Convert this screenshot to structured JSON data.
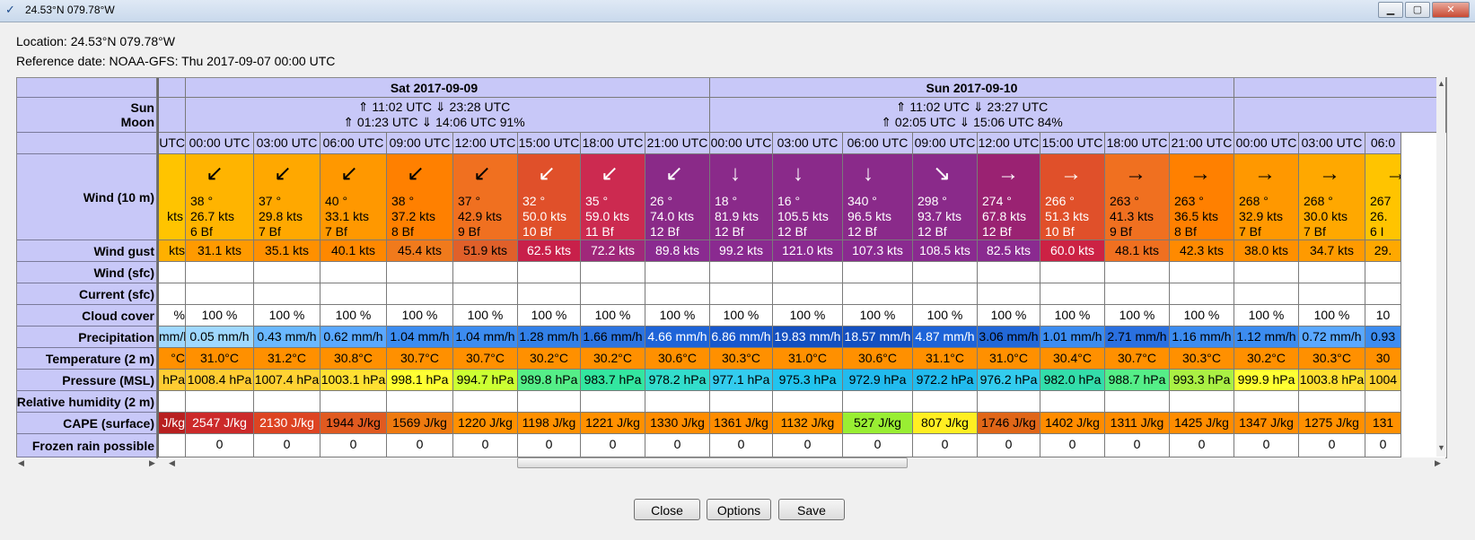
{
  "window": {
    "title": "24.53°N 079.78°W"
  },
  "location_text": "Location: 24.53°N 079.78°W",
  "reference_text": "Reference date: NOAA-GFS: Thu 2017-09-07 00:00 UTC",
  "row_labels": {
    "sun": "Sun",
    "moon": "Moon",
    "wind": "Wind (10 m)",
    "gust": "Wind gust",
    "wind_sfc": "Wind (sfc)",
    "current": "Current (sfc)",
    "cloud": "Cloud cover",
    "precip": "Precipitation",
    "temp": "Temperature (2 m)",
    "pressure": "Pressure (MSL)",
    "humidity": "Relative humidity (2 m)",
    "cape": "CAPE (surface)",
    "frozen": "Frozen rain possible"
  },
  "days": [
    {
      "label": "Sat 2017-09-09",
      "sun": "⇑ 11:02 UTC ⇓ 23:28 UTC",
      "moon": "⇑ 01:23 UTC ⇓ 14:06 UTC  91%"
    },
    {
      "label": "Sun 2017-09-10",
      "sun": "⇑ 11:02 UTC ⇓ 23:27 UTC",
      "moon": "⇑ 02:05 UTC ⇓ 15:06 UTC  84%"
    }
  ],
  "partial_col": {
    "time": "UTC",
    "wind": "kts",
    "gust": "kts",
    "cloud": "%",
    "precip": "mm/h",
    "temp": "°C",
    "pressure": "hPa",
    "cape": "J/kg"
  },
  "columns": [
    {
      "time": "00:00 UTC",
      "dir": "38 °",
      "speed": "26.7  kts",
      "bf": "6 Bf",
      "gust": "31.1  kts",
      "cloud": "100 %",
      "precip": "0.05 mm/h",
      "temp": "31.0°C",
      "pressure": "1008.4 hPa",
      "cape": "2547 J/kg",
      "frozen": "0",
      "wind_color": "#ffb400",
      "gust_color": "#ff9a00",
      "precip_color": "#9fd8ff",
      "pressure_color": "#ffcc33",
      "cape_color": "#cc2a2a",
      "arrow": "↙"
    },
    {
      "time": "03:00 UTC",
      "dir": "37 °",
      "speed": "29.8  kts",
      "bf": "7 Bf",
      "gust": "35.1  kts",
      "cloud": "100 %",
      "precip": "0.43 mm/h",
      "temp": "31.2°C",
      "pressure": "1007.4 hPa",
      "cape": "2130 J/kg",
      "frozen": "0",
      "wind_color": "#ffa800",
      "gust_color": "#ff9000",
      "precip_color": "#6ab8ff",
      "pressure_color": "#ffd233",
      "cape_color": "#dd4422",
      "arrow": "↙"
    },
    {
      "time": "06:00 UTC",
      "dir": "40 °",
      "speed": "33.1  kts",
      "bf": "7 Bf",
      "gust": "40.1  kts",
      "cloud": "100 %",
      "precip": "0.62 mm/h",
      "temp": "30.8°C",
      "pressure": "1003.1 hPa",
      "cape": "1944 J/kg",
      "frozen": "0",
      "wind_color": "#ff9800",
      "gust_color": "#ff8800",
      "precip_color": "#5aa8ff",
      "pressure_color": "#ffe033",
      "cape_color": "#e05a20",
      "arrow": "↙"
    },
    {
      "time": "09:00 UTC",
      "dir": "38 °",
      "speed": "37.2  kts",
      "bf": "8 Bf",
      "gust": "45.4  kts",
      "cloud": "100 %",
      "precip": "1.04 mm/h",
      "temp": "30.7°C",
      "pressure": "998.1 hPa",
      "cape": "1569 J/kg",
      "frozen": "0",
      "wind_color": "#ff8000",
      "gust_color": "#f07a1c",
      "precip_color": "#3c8cf0",
      "pressure_color": "#ffff33",
      "cape_color": "#ee7a10",
      "arrow": "↙"
    },
    {
      "time": "12:00 UTC",
      "dir": "37 °",
      "speed": "42.9  kts",
      "bf": "9 Bf",
      "gust": "51.9  kts",
      "cloud": "100 %",
      "precip": "1.04 mm/h",
      "temp": "30.7°C",
      "pressure": "994.7 hPa",
      "cape": "1220 J/kg",
      "frozen": "0",
      "wind_color": "#f07020",
      "gust_color": "#e0602a",
      "precip_color": "#3c8cf0",
      "pressure_color": "#ccff33",
      "cape_color": "#ff9000",
      "arrow": "↙"
    },
    {
      "time": "15:00 UTC",
      "dir": "32 °",
      "speed": "50.0  kts",
      "bf": "10 Bf",
      "gust": "62.5  kts",
      "cloud": "100 %",
      "precip": "1.28 mm/h",
      "temp": "30.2°C",
      "pressure": "989.8 hPa",
      "cape": "1198 J/kg",
      "frozen": "0",
      "wind_color": "#e0502a",
      "gust_color": "#c8204a",
      "precip_color": "#3280e8",
      "pressure_color": "#55ee88",
      "cape_color": "#ff9000",
      "arrow": "↙"
    },
    {
      "time": "18:00 UTC",
      "dir": "35 °",
      "speed": "59.0  kts",
      "bf": "11 Bf",
      "gust": "72.2  kts",
      "cloud": "100 %",
      "precip": "1.66 mm/h",
      "temp": "30.2°C",
      "pressure": "983.7 hPa",
      "cape": "1221 J/kg",
      "frozen": "0",
      "wind_color": "#cc2a50",
      "gust_color": "#a0287a",
      "precip_color": "#2c74e0",
      "pressure_color": "#33e6a0",
      "cape_color": "#ff9000",
      "arrow": "↙"
    },
    {
      "time": "21:00 UTC",
      "dir": "26 °",
      "speed": "74.0  kts",
      "bf": "12 Bf",
      "gust": "89.8  kts",
      "cloud": "100 %",
      "precip": "4.66 mm/h",
      "temp": "30.6°C",
      "pressure": "978.2 hPa",
      "cape": "1330 J/kg",
      "frozen": "0",
      "wind_color": "#8a2a88",
      "gust_color": "#8a2a90",
      "precip_color": "#1e64d8",
      "pressure_color": "#33ddcc",
      "cape_color": "#ff8c00",
      "arrow": "↙"
    },
    {
      "time": "00:00 UTC",
      "dir": "18 °",
      "speed": "81.9  kts",
      "bf": "12 Bf",
      "gust": "99.2  kts",
      "cloud": "100 %",
      "precip": "6.86 mm/h",
      "temp": "30.3°C",
      "pressure": "977.1 hPa",
      "cape": "1361 J/kg",
      "frozen": "0",
      "wind_color": "#8a2a8a",
      "gust_color": "#8a2a90",
      "precip_color": "#1858cc",
      "pressure_color": "#33ccee",
      "cape_color": "#ff8c00",
      "arrow": "↓"
    },
    {
      "time": "03:00 UTC",
      "dir": "16 °",
      "speed": "105.5  kts",
      "bf": "12 Bf",
      "gust": "121.0  kts",
      "cloud": "100 %",
      "precip": "19.83 mm/h",
      "temp": "31.0°C",
      "pressure": "975.3 hPa",
      "cape": "1132 J/kg",
      "frozen": "0",
      "wind_color": "#8a2a8a",
      "gust_color": "#8a2a90",
      "precip_color": "#1450c0",
      "pressure_color": "#22c4ee",
      "cape_color": "#ff9400",
      "arrow": "↓"
    },
    {
      "time": "06:00 UTC",
      "dir": "340 °",
      "speed": "96.5  kts",
      "bf": "12 Bf",
      "gust": "107.3  kts",
      "cloud": "100 %",
      "precip": "18.57 mm/h",
      "temp": "30.6°C",
      "pressure": "972.9 hPa",
      "cape": "527 J/kg",
      "frozen": "0",
      "wind_color": "#8a2a8a",
      "gust_color": "#8a2a90",
      "precip_color": "#1450c0",
      "pressure_color": "#22bbee",
      "cape_color": "#99ee33",
      "arrow": "↓"
    },
    {
      "time": "09:00 UTC",
      "dir": "298 °",
      "speed": "93.7  kts",
      "bf": "12 Bf",
      "gust": "108.5  kts",
      "cloud": "100 %",
      "precip": "4.87 mm/h",
      "temp": "31.1°C",
      "pressure": "972.2 hPa",
      "cape": "807 J/kg",
      "frozen": "0",
      "wind_color": "#8a2a8a",
      "gust_color": "#8a2a90",
      "precip_color": "#1e64d8",
      "pressure_color": "#22bbee",
      "cape_color": "#ffee22",
      "arrow": "↘"
    },
    {
      "time": "12:00 UTC",
      "dir": "274 °",
      "speed": "67.8  kts",
      "bf": "12 Bf",
      "gust": "82.5  kts",
      "cloud": "100 %",
      "precip": "3.06 mm/h",
      "temp": "31.0°C",
      "pressure": "976.2 hPa",
      "cape": "1746 J/kg",
      "frozen": "0",
      "wind_color": "#9a2272",
      "gust_color": "#8a2a90",
      "precip_color": "#2268d8",
      "pressure_color": "#33ccee",
      "cape_color": "#e06618",
      "arrow": "→"
    },
    {
      "time": "15:00 UTC",
      "dir": "266 °",
      "speed": "51.3  kts",
      "bf": "10 Bf",
      "gust": "60.0  kts",
      "cloud": "100 %",
      "precip": "1.01 mm/h",
      "temp": "30.4°C",
      "pressure": "982.0 hPa",
      "cape": "1402 J/kg",
      "frozen": "0",
      "wind_color": "#e0502a",
      "gust_color": "#cc2244",
      "precip_color": "#3c8cf0",
      "pressure_color": "#33ddaa",
      "cape_color": "#ff8c00",
      "arrow": "→"
    },
    {
      "time": "18:00 UTC",
      "dir": "263 °",
      "speed": "41.3  kts",
      "bf": "9 Bf",
      "gust": "48.1  kts",
      "cloud": "100 %",
      "precip": "2.71 mm/h",
      "temp": "30.7°C",
      "pressure": "988.7 hPa",
      "cape": "1311 J/kg",
      "frozen": "0",
      "wind_color": "#f07020",
      "gust_color": "#f07020",
      "precip_color": "#2a70e0",
      "pressure_color": "#55ee88",
      "cape_color": "#ff8c00",
      "arrow": "→"
    },
    {
      "time": "21:00 UTC",
      "dir": "263 °",
      "speed": "36.5  kts",
      "bf": "8 Bf",
      "gust": "42.3  kts",
      "cloud": "100 %",
      "precip": "1.16 mm/h",
      "temp": "30.3°C",
      "pressure": "993.3 hPa",
      "cape": "1425 J/kg",
      "frozen": "0",
      "wind_color": "#ff8000",
      "gust_color": "#ff8a00",
      "precip_color": "#3c8cf0",
      "pressure_color": "#aaf044",
      "cape_color": "#ff8c00",
      "arrow": "→"
    },
    {
      "time": "00:00 UTC",
      "dir": "268 °",
      "speed": "32.9  kts",
      "bf": "7 Bf",
      "gust": "38.0  kts",
      "cloud": "100 %",
      "precip": "1.12 mm/h",
      "temp": "30.2°C",
      "pressure": "999.9 hPa",
      "cape": "1347 J/kg",
      "frozen": "0",
      "wind_color": "#ff9800",
      "gust_color": "#ff9000",
      "precip_color": "#3c8cf0",
      "pressure_color": "#ffff33",
      "cape_color": "#ff8c00",
      "arrow": "→"
    },
    {
      "time": "03:00 UTC",
      "dir": "268 °",
      "speed": "30.0  kts",
      "bf": "7 Bf",
      "gust": "34.7  kts",
      "cloud": "100 %",
      "precip": "0.72 mm/h",
      "temp": "30.3°C",
      "pressure": "1003.8 hPa",
      "cape": "1275 J/kg",
      "frozen": "0",
      "wind_color": "#ffa800",
      "gust_color": "#ff9a00",
      "precip_color": "#5aa8ff",
      "pressure_color": "#ffe033",
      "cape_color": "#ff9000",
      "arrow": "→"
    },
    {
      "time": "06:0",
      "dir": "267",
      "speed": "26.",
      "bf": "6 I",
      "gust": "29.",
      "cloud": "10",
      "precip": "0.93",
      "temp": "30",
      "pressure": "1004",
      "cape": "131",
      "frozen": "0",
      "wind_color": "#ffc400",
      "gust_color": "#ffa800",
      "precip_color": "#3c8cf0",
      "pressure_color": "#ffd233",
      "cape_color": "#ff9000",
      "arrow": "→"
    }
  ],
  "buttons": {
    "close": "Close",
    "options": "Options",
    "save": "Save"
  },
  "colors": {
    "header_bg": "#c8c8f8",
    "temp_bg": "#ff9000"
  }
}
